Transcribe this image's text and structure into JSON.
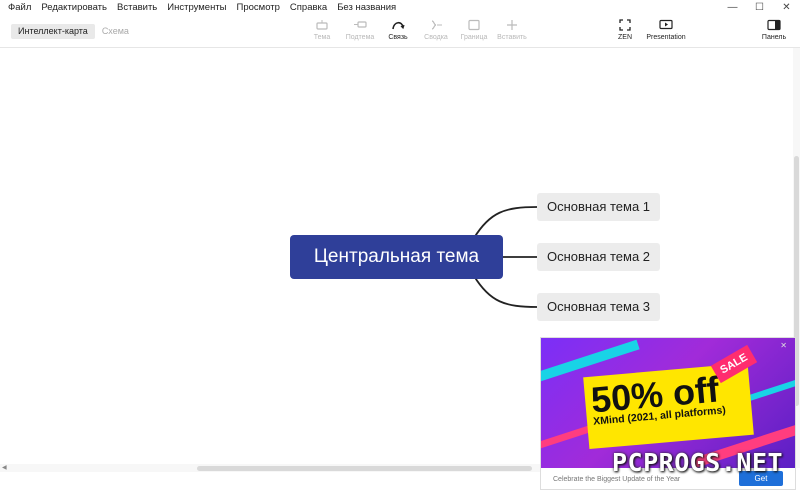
{
  "menu": [
    "Файл",
    "Редактировать",
    "Вставить",
    "Инструменты",
    "Просмотр",
    "Справка",
    "Без названия"
  ],
  "window_controls": {
    "minimize": "—",
    "maximize": "☐",
    "close": "✕"
  },
  "tabs": {
    "mindmap": "Интеллект-карта",
    "outline": "Схема"
  },
  "toolbar": {
    "topic": "Тема",
    "subtopic": "Подтема",
    "relationship": "Связь",
    "summary": "Сводка",
    "boundary": "Граница",
    "insert": "Вставить",
    "zen": "ZEN",
    "presentation": "Presentation",
    "panel": "Панель"
  },
  "map": {
    "central": "Центральная тема",
    "topics": [
      "Основная тема 1",
      "Основная тема 2",
      "Основная тема 3"
    ],
    "colors": {
      "central_fill": "#2f3f99",
      "topic_fill": "#ececec",
      "line": "#222222"
    }
  },
  "ad": {
    "sale": "SALE",
    "discount": "50% off",
    "product": "XMind (2021, all platforms)",
    "footer": "Celebrate the Biggest Update of the Year",
    "get": "Get",
    "close": "✕"
  },
  "watermark": "PCPROGS.NET"
}
